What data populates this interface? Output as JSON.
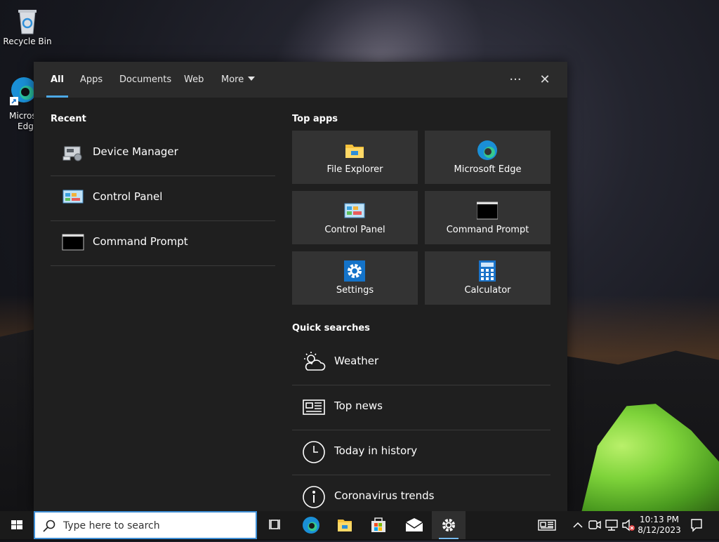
{
  "desktop": {
    "recycle_bin_label": "Recycle Bin",
    "edge_label_line1": "Micros",
    "edge_label_line2": "Edge"
  },
  "flyout": {
    "tabs": [
      {
        "label": "All",
        "active": true
      },
      {
        "label": "Apps",
        "active": false
      },
      {
        "label": "Documents",
        "active": false
      },
      {
        "label": "Web",
        "active": false
      },
      {
        "label": "More",
        "active": false
      }
    ],
    "options_glyph": "···",
    "close_glyph": "✕",
    "recent": {
      "title": "Recent",
      "items": [
        {
          "label": "Device Manager",
          "icon": "device-manager-icon"
        },
        {
          "label": "Control Panel",
          "icon": "control-panel-icon"
        },
        {
          "label": "Command Prompt",
          "icon": "command-prompt-icon"
        }
      ]
    },
    "top_apps": {
      "title": "Top apps",
      "tiles": [
        {
          "label": "File Explorer",
          "icon": "file-explorer-icon"
        },
        {
          "label": "Microsoft Edge",
          "icon": "edge-icon"
        },
        {
          "label": "Control Panel",
          "icon": "control-panel-icon"
        },
        {
          "label": "Command Prompt",
          "icon": "command-prompt-icon"
        },
        {
          "label": "Settings",
          "icon": "settings-icon"
        },
        {
          "label": "Calculator",
          "icon": "calculator-icon"
        }
      ]
    },
    "quick_searches": {
      "title": "Quick searches",
      "items": [
        {
          "label": "Weather",
          "icon": "weather-icon"
        },
        {
          "label": "Top news",
          "icon": "news-icon"
        },
        {
          "label": "Today in history",
          "icon": "clock-icon"
        },
        {
          "label": "Coronavirus trends",
          "icon": "info-icon"
        }
      ]
    }
  },
  "taskbar": {
    "search_placeholder": "Type here to search",
    "time": "10:13 PM",
    "date": "8/12/2023"
  },
  "colors": {
    "accent": "#4ca9e6",
    "flyout_bg": "#1f1f1f",
    "tile_bg": "#333333",
    "taskbar_bg": "#1a1a1a"
  }
}
